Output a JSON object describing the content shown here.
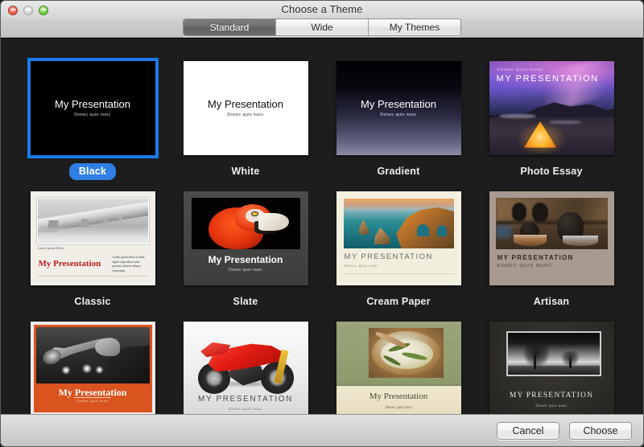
{
  "window": {
    "title": "Choose a Theme",
    "traffic_lights": [
      {
        "name": "close",
        "color": "#e8584a"
      },
      {
        "name": "minimize",
        "color": "#d2d2d2"
      },
      {
        "name": "zoom",
        "color": "#6bc63f"
      }
    ]
  },
  "segmented_control": {
    "selected": "Standard",
    "options": [
      "Standard",
      "Wide",
      "My Themes"
    ]
  },
  "slide_text": {
    "title_mixed": "My Presentation",
    "title_caps": "MY PRESENTATION",
    "subtitle_mixed": "Donec quis nunc",
    "subtitle_caps": "DONEC QUIS NUNC",
    "classic_caption": "Lorem Ipsum Dolor",
    "classic_body": "Lorem ipsum dolor sit amet, ligula suspendisse nulla pretium, rhoncus tempor fermentum."
  },
  "themes": [
    {
      "name": "Black",
      "selected": true,
      "style": "t-black"
    },
    {
      "name": "White",
      "selected": false,
      "style": "t-white"
    },
    {
      "name": "Gradient",
      "selected": false,
      "style": "t-gradient"
    },
    {
      "name": "Photo Essay",
      "selected": false,
      "style": "t-photo"
    },
    {
      "name": "Classic",
      "selected": false,
      "style": "t-classic"
    },
    {
      "name": "Slate",
      "selected": false,
      "style": "t-slate"
    },
    {
      "name": "Cream Paper",
      "selected": false,
      "style": "t-cream"
    },
    {
      "name": "Artisan",
      "selected": false,
      "style": "t-artisan"
    },
    {
      "name": "",
      "selected": false,
      "style": "t-showcase"
    },
    {
      "name": "",
      "selected": false,
      "style": "t-moto"
    },
    {
      "name": "",
      "selected": false,
      "style": "t-harvest"
    },
    {
      "name": "",
      "selected": false,
      "style": "t-trees"
    }
  ],
  "footer": {
    "cancel_label": "Cancel",
    "choose_label": "Choose"
  },
  "colors": {
    "selection_blue": "#1a7aea",
    "pill_blue": "#2f7fe5",
    "content_bg": "#1d1d1d"
  }
}
